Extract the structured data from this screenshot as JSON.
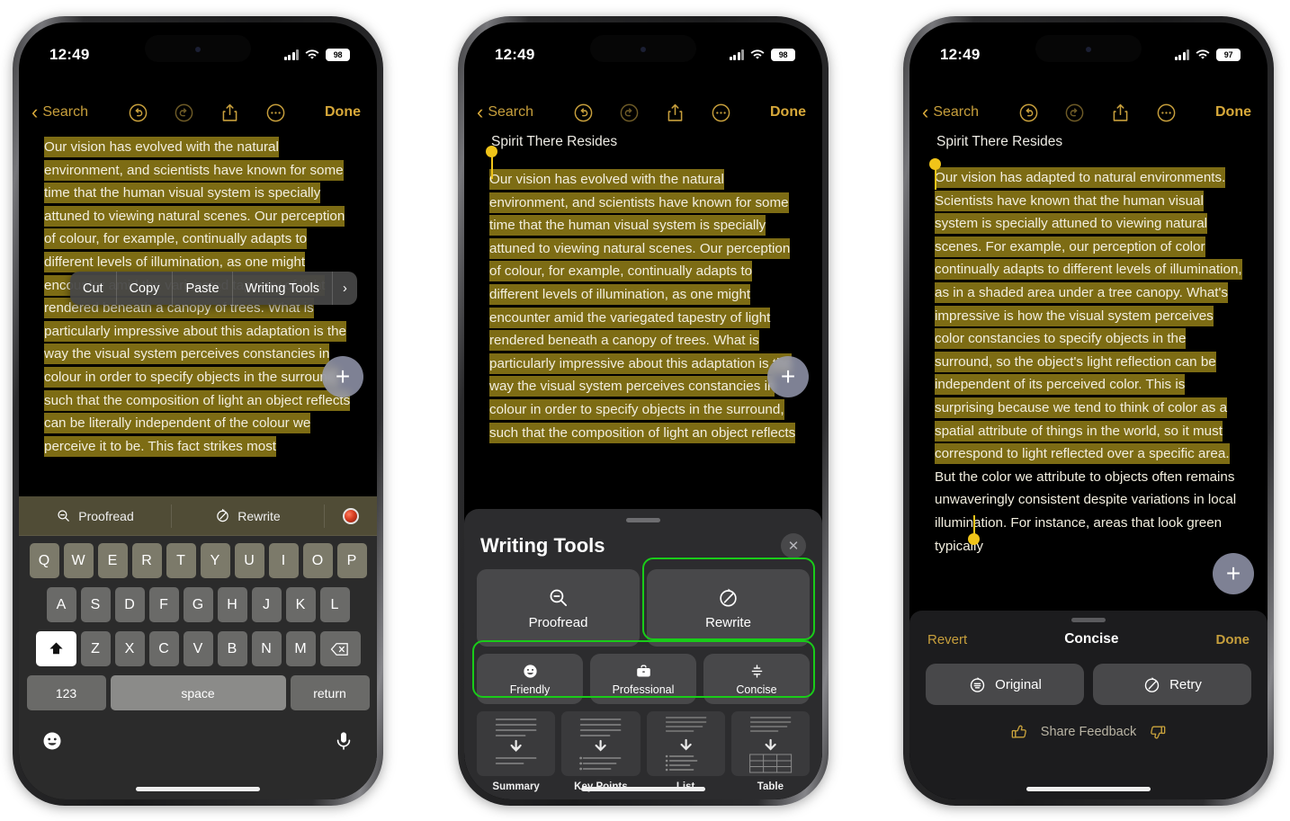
{
  "phones": [
    {
      "id": "phone-1",
      "status": {
        "time": "12:49",
        "battery": "98",
        "wifi": "wifi-icon",
        "cellular": "cellular-icon"
      },
      "nav": {
        "back_label": "Search",
        "done_label": "Done",
        "icons": [
          "undo-icon",
          "redo-icon",
          "share-icon",
          "more-icon"
        ]
      },
      "note": {
        "title": "",
        "body": "Our vision has evolved with the natural environment, and scientists have known for some time that the human visual system is specially attuned to viewing natural scenes. Our perception of colour, for example, continually adapts to different levels of illumination, as one might encounter amid the variegated tapestry of light rendered beneath a canopy of trees. What is particularly impressive about this adaptation is the way the visual system perceives constancies in colour in order to specify objects in the surround, such that the composition of light an object reflects can be literally independent of the colour we perceive it to be. This fact strikes most"
      },
      "context_menu": [
        "Cut",
        "Copy",
        "Paste",
        "Writing Tools",
        "›"
      ],
      "suggestion_bar": [
        {
          "label": "Proofread",
          "icon": "proofread-icon"
        },
        {
          "label": "Rewrite",
          "icon": "rewrite-icon"
        },
        {
          "label": "",
          "icon": "apple-intelligence-icon"
        }
      ],
      "keyboard": {
        "row1": [
          "Q",
          "W",
          "E",
          "R",
          "T",
          "Y",
          "U",
          "I",
          "O",
          "P"
        ],
        "row2": [
          "A",
          "S",
          "D",
          "F",
          "G",
          "H",
          "J",
          "K",
          "L"
        ],
        "row3_shift": "shift-icon",
        "row3": [
          "Z",
          "X",
          "C",
          "V",
          "B",
          "N",
          "M"
        ],
        "row3_delete": "delete-icon",
        "num_label": "123",
        "space_label": "space",
        "return_label": "return",
        "emoji_icon": "emoji-icon",
        "mic_icon": "microphone-icon"
      },
      "fab_label": "+"
    },
    {
      "id": "phone-2",
      "status": {
        "time": "12:49",
        "battery": "98",
        "wifi": "wifi-icon",
        "cellular": "cellular-icon"
      },
      "nav": {
        "back_label": "Search",
        "done_label": "Done",
        "icons": [
          "undo-icon",
          "redo-icon",
          "share-icon",
          "more-icon"
        ]
      },
      "note": {
        "title": "Spirit There Resides",
        "body": "Our vision has evolved with the natural environment, and scientists have known for some time that the human visual system is specially attuned to viewing natural scenes. Our perception of colour, for example, continually adapts to different levels of illumination, as one might encounter amid the variegated tapestry of light rendered beneath a canopy of trees. What is particularly impressive about this adaptation is the way the visual system perceives constancies in colour in order to specify objects in the surround, such that the composition of light an object reflects"
      },
      "writing_tools": {
        "title": "Writing Tools",
        "close_icon": "close-icon",
        "primary": [
          {
            "label": "Proofread",
            "icon": "proofread-icon",
            "highlighted": false
          },
          {
            "label": "Rewrite",
            "icon": "rewrite-icon",
            "highlighted": true
          }
        ],
        "tones": [
          {
            "label": "Friendly",
            "icon": "smiley-icon"
          },
          {
            "label": "Professional",
            "icon": "briefcase-icon"
          },
          {
            "label": "Concise",
            "icon": "concise-icon"
          }
        ],
        "formats": [
          {
            "label": "Summary",
            "icon": "summary-thumb-icon"
          },
          {
            "label": "Key Points",
            "icon": "keypoints-thumb-icon"
          },
          {
            "label": "List",
            "icon": "list-thumb-icon"
          },
          {
            "label": "Table",
            "icon": "table-thumb-icon"
          }
        ]
      },
      "fab_label": "+"
    },
    {
      "id": "phone-3",
      "status": {
        "time": "12:49",
        "battery": "97",
        "wifi": "wifi-icon",
        "cellular": "cellular-icon"
      },
      "nav": {
        "back_label": "Search",
        "done_label": "Done",
        "icons": [
          "undo-icon",
          "redo-icon",
          "share-icon",
          "more-icon"
        ]
      },
      "note": {
        "title": "Spirit There Resides",
        "body_highlighted": "Our vision has adapted to natural environments. Scientists have known that the human visual system is specially attuned to viewing natural scenes. For example, our perception of color continually adapts to different levels of illumination, as in a shaded area under a tree canopy. What's impressive is how the visual system perceives color constancies to specify objects in the surround, so the object's light reflection can be independent of its perceived color. This is surprising because we tend to think of color as a spatial attribute of things in the world, so it must correspond to light reflected over a specific area.",
        "body_plain": " But the color we attribute to objects often remains unwaveringly consistent despite variations in local illumination. For instance, areas that look green typically"
      },
      "result_sheet": {
        "revert_label": "Revert",
        "title": "Concise",
        "done_label": "Done",
        "buttons": [
          {
            "label": "Original",
            "icon": "original-icon"
          },
          {
            "label": "Retry",
            "icon": "rewrite-icon"
          }
        ],
        "feedback_label": "Share Feedback",
        "thumbs_up_icon": "thumbs-up-icon",
        "thumbs_down_icon": "thumbs-down-icon"
      },
      "fab_label": "+"
    }
  ],
  "colors": {
    "highlight": "#7d6c14",
    "accent_gold": "#c79f3c",
    "annotation_green": "#19cc19",
    "handle": "#f0c419",
    "sheet_bg": "#2c2c2e",
    "card_bg": "#48484a"
  }
}
